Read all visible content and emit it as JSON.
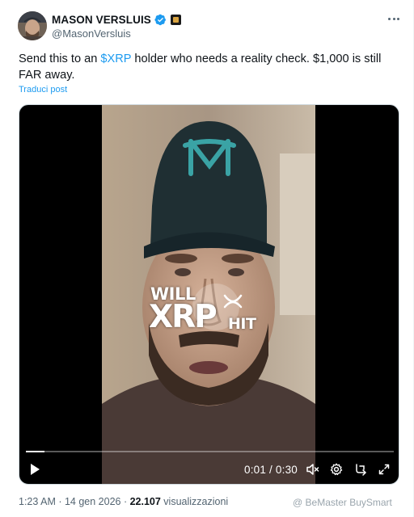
{
  "author": {
    "display_name": "MASON VERSLUIS",
    "handle": "@MasonVersluis"
  },
  "post": {
    "text_before": "Send this to an ",
    "cashtag": "$XRP",
    "text_after": " holder who needs a reality check. $1,000 is still FAR away.",
    "translate_label": "Traduci post"
  },
  "video": {
    "overlay_will": "WILL",
    "overlay_xrp": "XRP",
    "overlay_hit": "HIT",
    "time_display": "0:01 / 0:30",
    "progress_fraction": 0.05
  },
  "meta": {
    "timestamp": "1:23 AM · 14 gen 2026 · ",
    "views_count": "22.107",
    "views_label": " visualizzazioni"
  },
  "watermark": {
    "text": "@ BeMaster BuySmart"
  },
  "colors": {
    "accent": "#1d9bf0",
    "verified": "#1d9bf0",
    "text_secondary": "#536471"
  }
}
